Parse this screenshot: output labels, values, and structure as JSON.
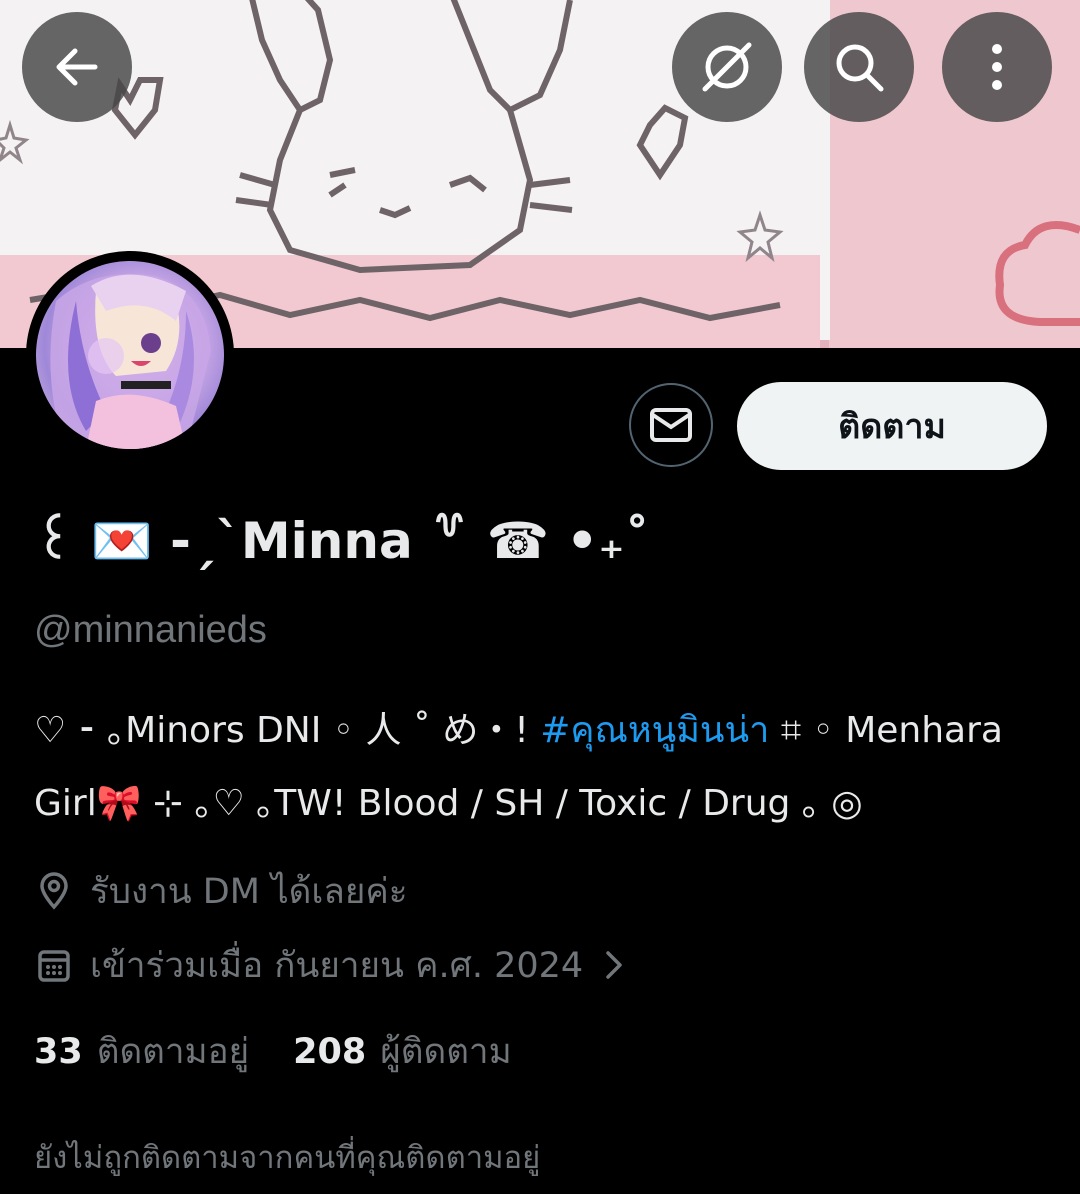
{
  "header": {
    "back_icon": "arrow-left-icon",
    "grok_icon": "grok-icon",
    "search_icon": "search-icon",
    "more_icon": "more-vertical-icon"
  },
  "profile": {
    "display_name": "꒰ 💌 -ˏˋMinna ꒷ ☎︎ •₊˚",
    "handle": "@minnanieds",
    "bio_part1": "♡ ⁃ ｡Minors DNI ◦ 人 ˚ め・! ",
    "bio_hashtag": "#คุณหนูมินน่า",
    "bio_part2": " ⌗ ◦ Menhara Girl🎀 ⊹ ｡♡ ｡TW! Blood / SH / Toxic / Drug ｡ ◎",
    "location": "รับงาน DM ได้เลยค่ะ",
    "joined": "เข้าร่วมเมื่อ กันยายน ค.ศ. 2024",
    "following_count": "33",
    "following_label": "ติดตามอยู่",
    "followers_count": "208",
    "followers_label": "ผู้ติดตาม",
    "not_followed_note": "ยังไม่ถูกติดตามจากคนที่คุณติดตามอยู่"
  },
  "actions": {
    "follow_label": "ติดตาม",
    "message_icon": "mail-icon"
  },
  "colors": {
    "background": "#000000",
    "text_primary": "#e7e9ea",
    "text_secondary": "#71767b",
    "link": "#1d9bf0",
    "follow_button_bg": "#eff3f4"
  }
}
